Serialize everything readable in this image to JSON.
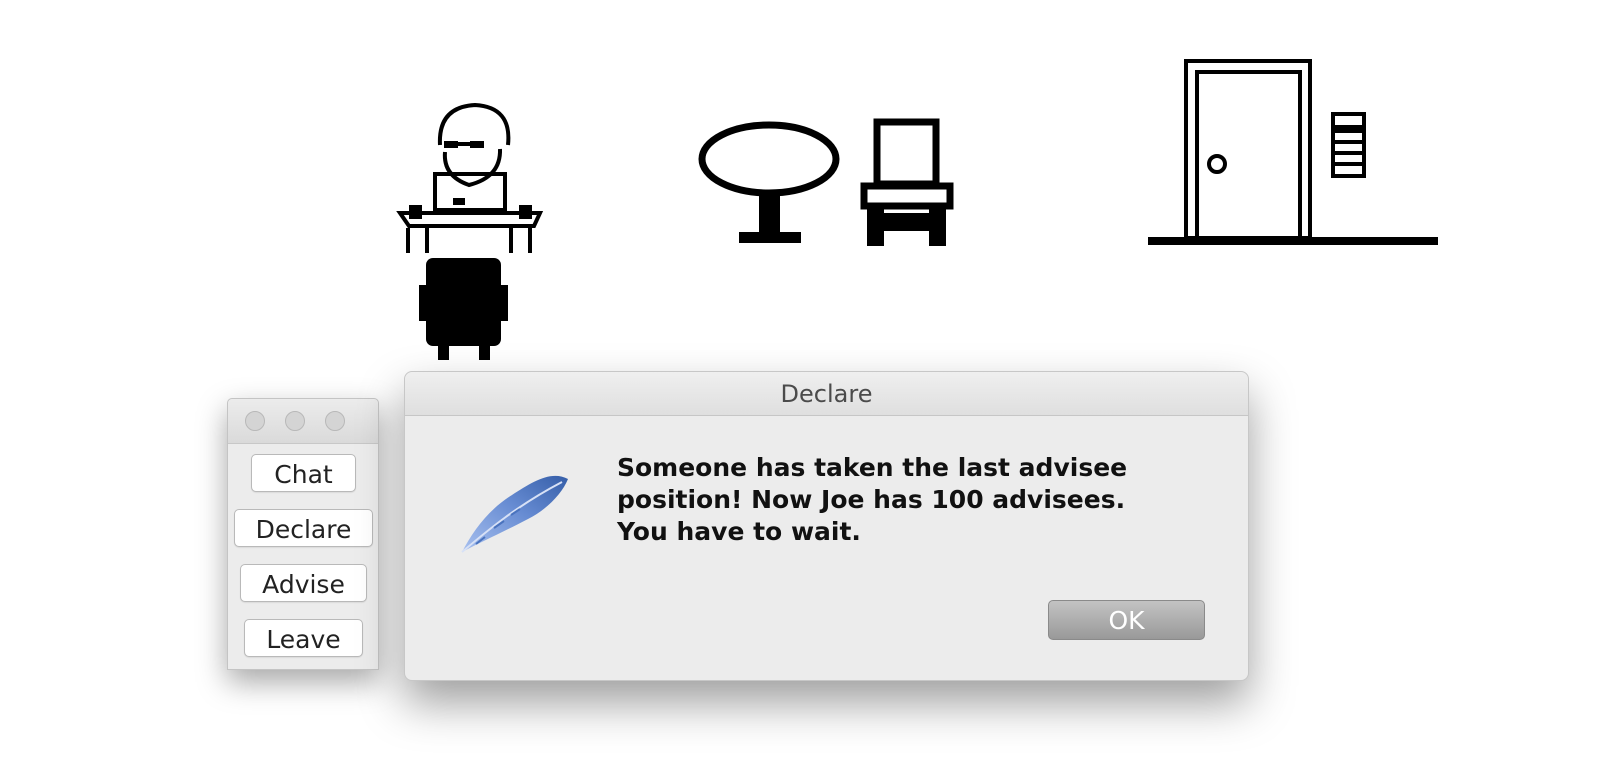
{
  "scene": {
    "icons": [
      "person-at-desk-icon",
      "table-icon",
      "chair-icon",
      "door-icon",
      "elevator-call-panel-icon"
    ],
    "colors": {
      "pixel_art": "#000000",
      "background": "#ffffff"
    }
  },
  "control_window": {
    "buttons": {
      "chat": "Chat",
      "declare": "Declare",
      "advise": "Advise",
      "leave": "Leave"
    }
  },
  "dialog": {
    "title": "Declare",
    "icon": "feather-icon",
    "message": "Someone has taken the last advisee position! Now Joe has 100 advisees. You have to wait.",
    "ok_label": "OK",
    "colors": {
      "feather": "#6f93d6",
      "ok_button": "#a5a5a5",
      "background": "#ececec"
    }
  }
}
